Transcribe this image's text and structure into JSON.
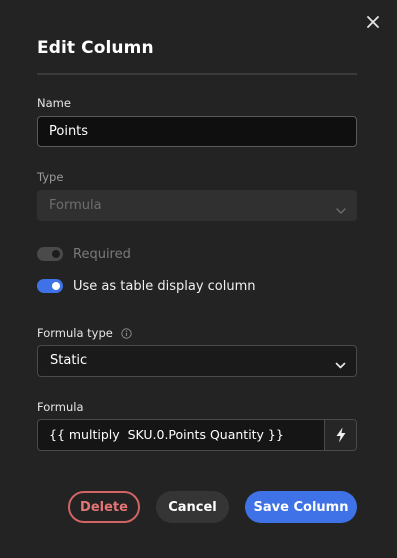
{
  "dialog": {
    "title": "Edit Column",
    "close_icon": "close-icon"
  },
  "name": {
    "label": "Name",
    "value": "Points"
  },
  "type": {
    "label": "Type",
    "value": "Formula",
    "disabled": true,
    "icon": "chevron-down-icon"
  },
  "toggles": {
    "required": {
      "label": "Required",
      "on": false,
      "disabled": true
    },
    "display_column": {
      "label": "Use as table display column",
      "on": true,
      "disabled": false
    }
  },
  "formula_type": {
    "label": "Formula type",
    "info_icon": "info-icon",
    "value": "Static",
    "icon": "chevron-down-icon"
  },
  "formula": {
    "label": "Formula",
    "value": "{{ multiply  SKU.0.Points Quantity }}",
    "action_icon": "lightning-icon"
  },
  "buttons": {
    "delete": "Delete",
    "cancel": "Cancel",
    "save": "Save Column"
  },
  "colors": {
    "background": "#232323",
    "accent": "#3f72e6",
    "danger": "#d16464"
  }
}
